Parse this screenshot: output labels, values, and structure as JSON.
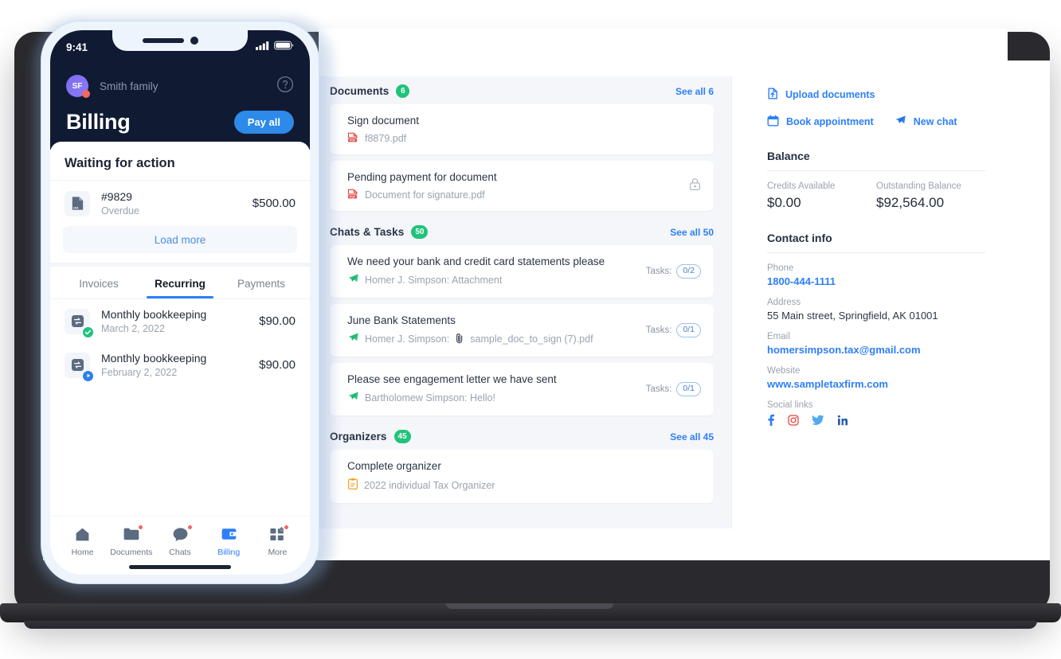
{
  "colors": {
    "accent_blue": "#2d7ff9",
    "phone_header_dark": "#101a33",
    "badge_green": "#21c37a",
    "pdf_red": "#e8453c",
    "avatar_purple": "#7b6bf0",
    "notify_red": "#f4685f",
    "panel_bg": "#f4f6fa"
  },
  "phone": {
    "status_bar": {
      "time": "9:41",
      "signal_icon": "cellular-signal-icon",
      "battery_icon": "battery-icon"
    },
    "account": {
      "avatar_initials": "SF",
      "name": "Smith family",
      "help_icon": "help-circle-icon",
      "has_notification_dot": true
    },
    "header": {
      "title": "Billing",
      "pay_all_label": "Pay all"
    },
    "waiting": {
      "heading": "Waiting for action",
      "invoice": {
        "icon": "invoice-document-icon",
        "number": "#9829",
        "status": "Overdue",
        "amount": "$500.00"
      },
      "load_more_label": "Load more"
    },
    "tabs": [
      {
        "label": "Invoices",
        "active": false
      },
      {
        "label": "Recurring",
        "active": true
      },
      {
        "label": "Payments",
        "active": false
      }
    ],
    "recurring": [
      {
        "icon": "recurring-sync-icon",
        "badge": "check-badge-icon",
        "name": "Monthly bookkeeping",
        "date": "March 2, 2022",
        "amount": "$90.00"
      },
      {
        "icon": "recurring-sync-icon",
        "badge": "play-badge-icon",
        "name": "Monthly bookkeeping",
        "date": "February 2, 2022",
        "amount": "$90.00"
      }
    ],
    "tabbar": [
      {
        "label": "Home",
        "icon": "home-icon",
        "active": false,
        "dot": false
      },
      {
        "label": "Documents",
        "icon": "folder-icon",
        "active": false,
        "dot": true
      },
      {
        "label": "Chats",
        "icon": "chat-bubble-icon",
        "active": false,
        "dot": true
      },
      {
        "label": "Billing",
        "icon": "wallet-icon",
        "active": true,
        "dot": false
      },
      {
        "label": "More",
        "icon": "grid-plus-icon",
        "active": false,
        "dot": true
      }
    ]
  },
  "desktop": {
    "sections": [
      {
        "title": "Documents",
        "badge": "6",
        "see_all": "See all 6",
        "items": [
          {
            "title": "Sign document",
            "sub_icon": "pdf-file-icon",
            "sub": "f8879.pdf",
            "right": null
          },
          {
            "title": "Pending payment for document",
            "sub_icon": "pdf-file-icon",
            "sub": "Document for signature.pdf",
            "right": "lock-icon"
          }
        ]
      },
      {
        "title": "Chats & Tasks",
        "badge": "50",
        "see_all": "See all 50",
        "items": [
          {
            "title": "We need your bank and credit card statements please",
            "sub_icon": "send-paper-plane-icon",
            "sub": "Homer J. Simpson: Attachment",
            "tasks_label": "Tasks:",
            "tasks_value": "0/2"
          },
          {
            "title": "June Bank Statements",
            "sub_icon": "send-paper-plane-icon",
            "sub": "Homer J. Simpson:",
            "attachment_icon": "paperclip-icon",
            "sub2": "sample_doc_to_sign (7).pdf",
            "tasks_label": "Tasks:",
            "tasks_value": "0/1"
          },
          {
            "title": "Please see engagement letter we have sent",
            "sub_icon": "send-paper-plane-icon",
            "sub": "Bartholomew Simpson: Hello!",
            "tasks_label": "Tasks:",
            "tasks_value": "0/1"
          }
        ]
      },
      {
        "title": "Organizers",
        "badge": "45",
        "see_all": "See all 45",
        "items": [
          {
            "title": "Complete organizer",
            "sub_icon": "organizer-clipboard-icon",
            "sub": "2022 individual Tax Organizer",
            "right": null
          }
        ]
      }
    ],
    "quick_actions": [
      {
        "label": "Upload documents",
        "icon": "upload-document-icon"
      },
      {
        "label": "Book appointment",
        "icon": "calendar-icon"
      },
      {
        "label": "New chat",
        "icon": "send-paper-plane-icon"
      }
    ],
    "balance": {
      "heading": "Balance",
      "credits_label": "Credits Available",
      "credits_value": "$0.00",
      "outstanding_label": "Outstanding Balance",
      "outstanding_value": "$92,564.00"
    },
    "contact": {
      "heading": "Contact info",
      "phone_label": "Phone",
      "phone_value": "1800-444-1111",
      "address_label": "Address",
      "address_value": "55 Main street, Springfield, AK 01001",
      "email_label": "Email",
      "email_value": "homersimpson.tax@gmail.com",
      "website_label": "Website",
      "website_value": "www.sampletaxfirm.com",
      "social_label": "Social links",
      "socials": [
        {
          "name": "facebook-icon"
        },
        {
          "name": "instagram-icon"
        },
        {
          "name": "twitter-icon"
        },
        {
          "name": "linkedin-icon"
        }
      ]
    }
  }
}
